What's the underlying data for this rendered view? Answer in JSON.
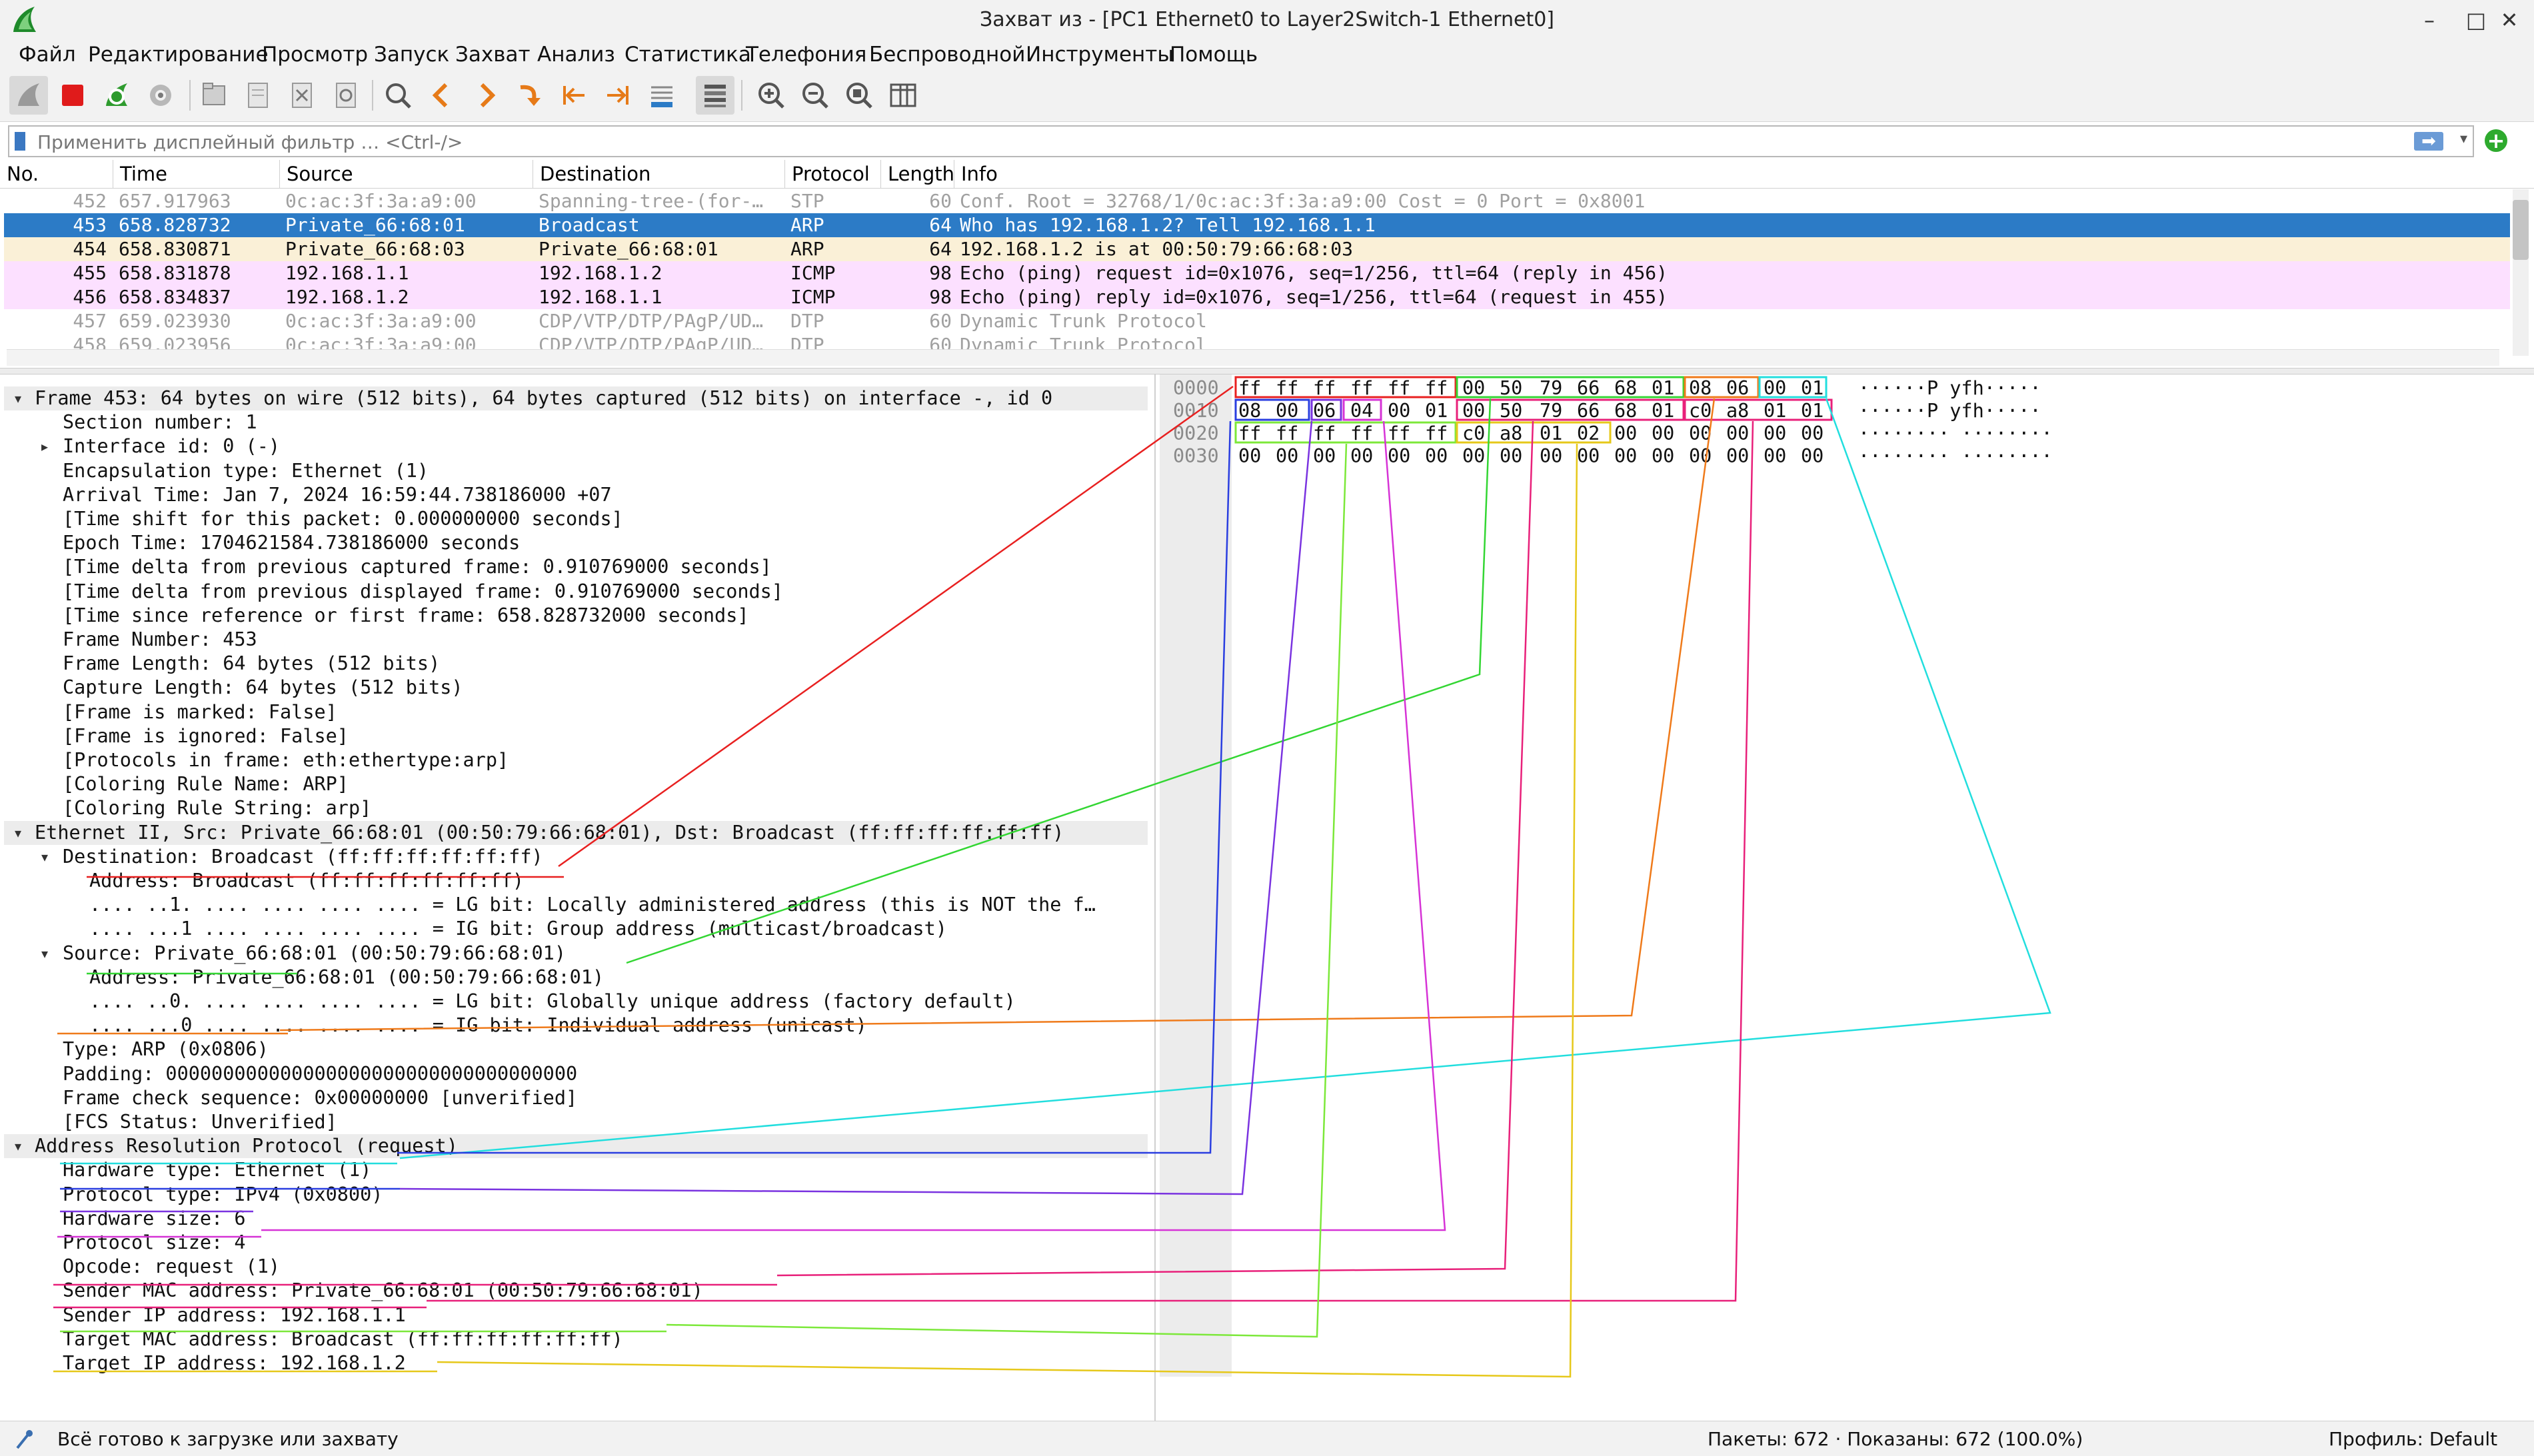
{
  "window": {
    "title": "Захват из - [PC1 Ethernet0 to Layer2Switch-1 Ethernet0]",
    "minimize": "–",
    "maximize": "□",
    "close": "✕"
  },
  "menu": [
    "Файл",
    "Редактирование",
    "Просмотр",
    "Запуск",
    "Захват",
    "Анализ",
    "Статистика",
    "Телефония",
    "Беспроводной",
    "Инструменты",
    "Помощь"
  ],
  "toolbar": [
    "shark-fin-start-icon",
    "stop-capture-icon",
    "restart-capture-icon",
    "capture-options-icon",
    "open-file-icon",
    "save-file-icon",
    "close-file-icon",
    "reload-file-icon",
    "find-packet-icon",
    "go-back-icon",
    "go-forward-icon",
    "go-to-packet-icon",
    "go-first-icon",
    "go-last-icon",
    "autoscroll-icon",
    "colorize-icon",
    "zoom-in-icon",
    "zoom-out-icon",
    "normal-size-icon",
    "resize-columns-icon"
  ],
  "filter": {
    "placeholder": "Применить дисплейный фильтр … <Ctrl-/>",
    "value": ""
  },
  "colors": {
    "selected": "#2c7bc6",
    "arp": "#faf0d7",
    "icmp": "#fce0ff",
    "grey_text": "#a0a0a0"
  },
  "packet_list": {
    "columns": [
      "No.",
      "Time",
      "Source",
      "Destination",
      "Protocol",
      "Length",
      "Info"
    ],
    "rows": [
      {
        "no": "452",
        "time": "657.917963",
        "src": "0c:ac:3f:3a:a9:00",
        "dst": "Spanning-tree-(for-…",
        "proto": "STP",
        "len": "60",
        "info": "Conf. Root = 32768/1/0c:ac:3f:3a:a9:00  Cost = 0  Port = 0x8001"
      },
      {
        "no": "453",
        "time": "658.828732",
        "src": "Private_66:68:01",
        "dst": "Broadcast",
        "proto": "ARP",
        "len": "64",
        "info": "Who has 192.168.1.2? Tell 192.168.1.1"
      },
      {
        "no": "454",
        "time": "658.830871",
        "src": "Private_66:68:03",
        "dst": "Private_66:68:01",
        "proto": "ARP",
        "len": "64",
        "info": "192.168.1.2 is at 00:50:79:66:68:03"
      },
      {
        "no": "455",
        "time": "658.831878",
        "src": "192.168.1.1",
        "dst": "192.168.1.2",
        "proto": "ICMP",
        "len": "98",
        "info": "Echo (ping) request  id=0x1076, seq=1/256, ttl=64 (reply in 456)"
      },
      {
        "no": "456",
        "time": "658.834837",
        "src": "192.168.1.2",
        "dst": "192.168.1.1",
        "proto": "ICMP",
        "len": "98",
        "info": "Echo (ping) reply    id=0x1076, seq=1/256, ttl=64 (request in 455)"
      },
      {
        "no": "457",
        "time": "659.023930",
        "src": "0c:ac:3f:3a:a9:00",
        "dst": "CDP/VTP/DTP/PAgP/UD…",
        "proto": "DTP",
        "len": "60",
        "info": "Dynamic Trunk Protocol"
      },
      {
        "no": "458",
        "time": "659.023956",
        "src": "0c:ac:3f:3a:a9:00",
        "dst": "CDP/VTP/DTP/PAgP/UD…",
        "proto": "DTP",
        "len": "60",
        "info": "Dynamic Trunk Protocol"
      }
    ]
  },
  "details": [
    "Frame 453: 64 bytes on wire (512 bits), 64 bytes captured (512 bits) on interface -, id 0",
    "Section number: 1",
    "Interface id: 0 (-)",
    "Encapsulation type: Ethernet (1)",
    "Arrival Time: Jan  7, 2024 16:59:44.738186000 +07",
    "[Time shift for this packet: 0.000000000 seconds]",
    "Epoch Time: 1704621584.738186000 seconds",
    "[Time delta from previous captured frame: 0.910769000 seconds]",
    "[Time delta from previous displayed frame: 0.910769000 seconds]",
    "[Time since reference or first frame: 658.828732000 seconds]",
    "Frame Number: 453",
    "Frame Length: 64 bytes (512 bits)",
    "Capture Length: 64 bytes (512 bits)",
    "[Frame is marked: False]",
    "[Frame is ignored: False]",
    "[Protocols in frame: eth:ethertype:arp]",
    "[Coloring Rule Name: ARP]",
    "[Coloring Rule String: arp]",
    "Ethernet II, Src: Private_66:68:01 (00:50:79:66:68:01), Dst: Broadcast (ff:ff:ff:ff:ff:ff)",
    "Destination: Broadcast (ff:ff:ff:ff:ff:ff)",
    "Address: Broadcast (ff:ff:ff:ff:ff:ff)",
    ".... ..1. .... .... .... .... = LG bit: Locally administered address (this is NOT the f…",
    ".... ...1 .... .... .... .... = IG bit: Group address (multicast/broadcast)",
    "Source: Private_66:68:01 (00:50:79:66:68:01)",
    "Address: Private_66:68:01 (00:50:79:66:68:01)",
    ".... ..0. .... .... .... .... = LG bit: Globally unique address (factory default)",
    ".... ...0 .... .... .... .... = IG bit: Individual address (unicast)",
    "Type: ARP (0x0806)",
    "Padding: 000000000000000000000000000000000000",
    "Frame check sequence: 0x00000000 [unverified]",
    "[FCS Status: Unverified]",
    "Address Resolution Protocol (request)",
    "Hardware type: Ethernet (1)",
    "Protocol type: IPv4 (0x0800)",
    "Hardware size: 6",
    "Protocol size: 4",
    "Opcode: request (1)",
    "Sender MAC address: Private_66:68:01 (00:50:79:66:68:01)",
    "Sender IP address: 192.168.1.1",
    "Target MAC address: Broadcast (ff:ff:ff:ff:ff:ff)",
    "Target IP address: 192.168.1.2"
  ],
  "bytes": [
    {
      "offset": "0000",
      "hex": [
        "ff",
        "ff",
        "ff",
        "ff",
        "ff",
        "ff",
        "00",
        "50",
        "79",
        "66",
        "68",
        "01",
        "08",
        "06",
        "00",
        "01"
      ],
      "ascii": "······P yfh·····"
    },
    {
      "offset": "0010",
      "hex": [
        "08",
        "00",
        "06",
        "04",
        "00",
        "01",
        "00",
        "50",
        "79",
        "66",
        "68",
        "01",
        "c0",
        "a8",
        "01",
        "01"
      ],
      "ascii": "······P yfh·····"
    },
    {
      "offset": "0020",
      "hex": [
        "ff",
        "ff",
        "ff",
        "ff",
        "ff",
        "ff",
        "c0",
        "a8",
        "01",
        "02",
        "00",
        "00",
        "00",
        "00",
        "00",
        "00"
      ],
      "ascii": "········ ········"
    },
    {
      "offset": "0030",
      "hex": [
        "00",
        "00",
        "00",
        "00",
        "00",
        "00",
        "00",
        "00",
        "00",
        "00",
        "00",
        "00",
        "00",
        "00",
        "00",
        "00"
      ],
      "ascii": "········ ········"
    }
  ],
  "status": {
    "text": "Всё готово к загрузке или захвату",
    "packets": "Пакеты: 672 · Показаны: 672 (100.0%)",
    "profile": "Профиль: Default"
  }
}
